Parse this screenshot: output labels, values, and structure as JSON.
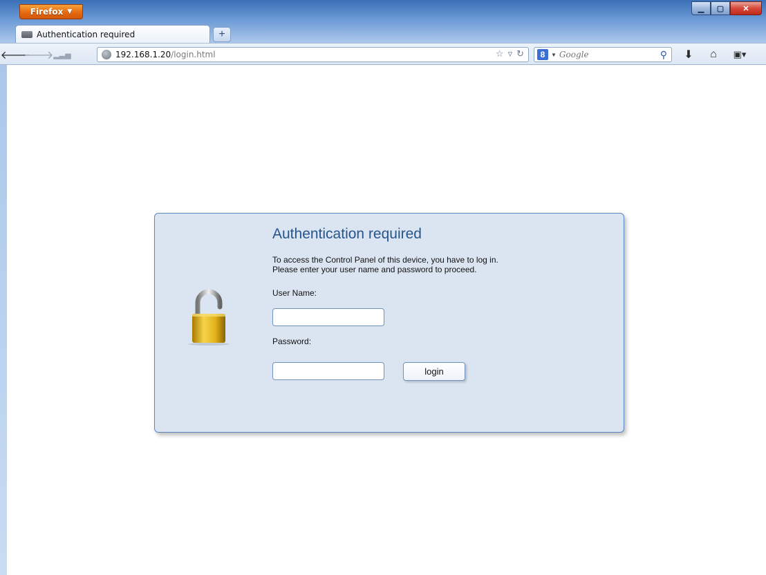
{
  "browser": {
    "menu_label": "Firefox",
    "tab_title": "Authentication required",
    "url_host": "192.168.1.20",
    "url_path": "/login.html",
    "search_placeholder": "Google"
  },
  "auth": {
    "title": "Authentication required",
    "desc_line1": "To access the Control Panel of this device, you have to log in.",
    "desc_line2": "Please enter your user name and password to proceed.",
    "user_label": "User Name:",
    "pass_label": "Password:",
    "login_label": "login"
  }
}
